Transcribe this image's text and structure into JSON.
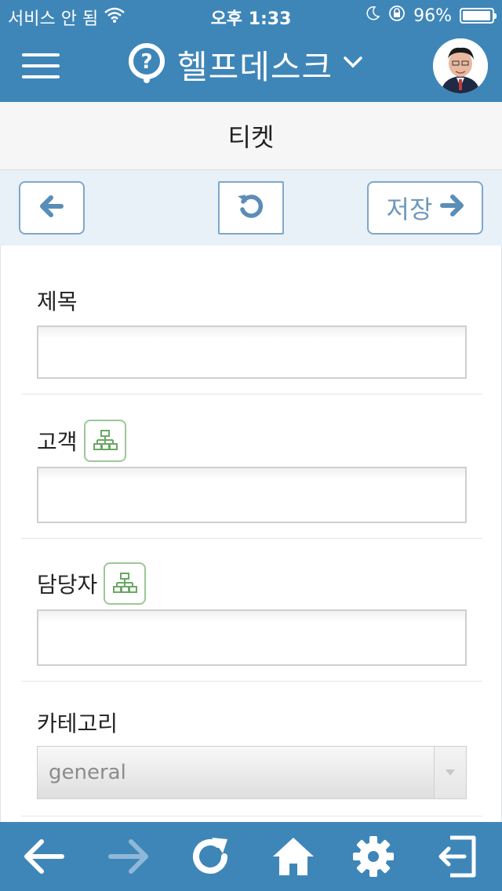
{
  "status_bar": {
    "carrier": "서비스 안 됨",
    "time": "오후 1:33",
    "battery": "96%",
    "battery_level": 0.96
  },
  "app_bar": {
    "title": "헬프데스크",
    "icons": [
      "menu-icon",
      "help-icon",
      "chevron-down-icon",
      "avatar"
    ]
  },
  "page": {
    "title": "티켓"
  },
  "toolbar": {
    "save_label": "저장",
    "icons": [
      "arrow-left-icon",
      "refresh-icon",
      "arrow-right-icon"
    ]
  },
  "form": {
    "subject_label": "제목",
    "subject_value": "",
    "customer_label": "고객",
    "customer_value": "",
    "assignee_label": "담당자",
    "assignee_value": "",
    "category_label": "카테고리",
    "category_value": "general"
  },
  "bottom_bar": {
    "icons": [
      "back-icon",
      "forward-icon",
      "reload-icon",
      "home-icon",
      "settings-icon",
      "logout-icon"
    ]
  },
  "colors": {
    "primary": "#3f86b8",
    "toolbar_bg": "#e8f0f8",
    "org_button_border": "#9cc796"
  }
}
